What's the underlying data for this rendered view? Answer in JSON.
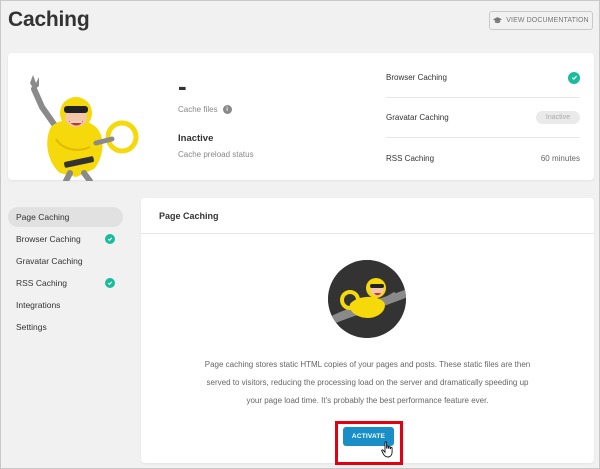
{
  "header": {
    "title": "Caching",
    "doc_button_label": "VIEW DOCUMENTATION"
  },
  "summary": {
    "cache_files_value": "-",
    "cache_files_label": "Cache files",
    "preload_value": "Inactive",
    "preload_label": "Cache preload status",
    "statuses": [
      {
        "label": "Browser Caching",
        "state": "active"
      },
      {
        "label": "Gravatar Caching",
        "state": "Inactive"
      },
      {
        "label": "RSS Caching",
        "value": "60 minutes"
      }
    ]
  },
  "sidebar": {
    "items": [
      {
        "label": "Page Caching",
        "active": true
      },
      {
        "label": "Browser Caching",
        "checked": true
      },
      {
        "label": "Gravatar Caching"
      },
      {
        "label": "RSS Caching",
        "checked": true
      },
      {
        "label": "Integrations"
      },
      {
        "label": "Settings"
      }
    ]
  },
  "panel": {
    "title": "Page Caching",
    "description_lines": [
      "Page caching stores static HTML copies of your pages and posts. These static files are then",
      "served to visitors, reducing the processing load on the server and dramatically speeding up",
      "your page load time. It's probably the best performance feature ever."
    ],
    "activate_label": "ACTIVATE"
  },
  "colors": {
    "accent_blue": "#1a8fc7",
    "success_green": "#1abc9c",
    "highlight_red": "#e3000f",
    "mascot_yellow": "#f5d90a"
  },
  "icons": {
    "doc_button": "graduation-cap-icon",
    "info": "info-icon",
    "check": "check-circle-icon",
    "cursor": "hand-pointer-icon"
  }
}
